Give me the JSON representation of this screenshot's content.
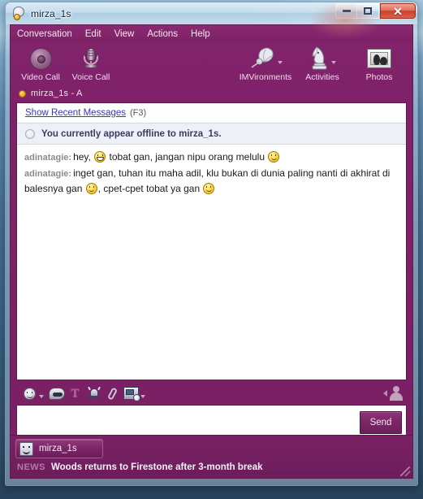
{
  "window": {
    "title": "mirza_1s",
    "title_icon": "yahoo-messenger-icon",
    "controls": {
      "minimize": "minimize-icon",
      "maximize": "maximize-icon",
      "close": "✕"
    }
  },
  "menu": {
    "items": [
      {
        "label": "Conversation"
      },
      {
        "label": "Edit"
      },
      {
        "label": "View"
      },
      {
        "label": "Actions"
      },
      {
        "label": "Help"
      }
    ]
  },
  "toolbar": {
    "left": [
      {
        "label": "Video Call",
        "icon": "webcam-icon"
      },
      {
        "label": "Voice Call",
        "icon": "microphone-icon"
      }
    ],
    "right": [
      {
        "label": "IMVironments",
        "icon": "leaf-icon"
      },
      {
        "label": "Activities",
        "icon": "chess-knight-icon"
      },
      {
        "label": "Photos",
        "icon": "photo-frame-icon"
      }
    ]
  },
  "im_status": {
    "dot_color": "#f0a91d",
    "text": "mirza_1s  -  A"
  },
  "chat": {
    "recent_link": "Show Recent Messages",
    "recent_shortcut": "(F3)",
    "offline_notice": "You currently appear offline to mirza_1s.",
    "messages": [
      {
        "sender": "adinatagie:",
        "segments": [
          {
            "type": "text",
            "value": "hey, "
          },
          {
            "type": "emoticon",
            "value": "grin"
          },
          {
            "type": "text",
            "value": " tobat gan, jangan nipu orang melulu "
          },
          {
            "type": "emoticon",
            "value": "smile"
          }
        ]
      },
      {
        "sender": "adinatagie:",
        "segments": [
          {
            "type": "text",
            "value": "inget gan, tuhan itu maha adil, klu bukan di dunia paling nanti di akhirat di balesnya gan "
          },
          {
            "type": "emoticon",
            "value": "smile"
          },
          {
            "type": "text",
            "value": ", cpet-cpet tobat ya gan "
          },
          {
            "type": "emoticon",
            "value": "smile"
          }
        ]
      }
    ]
  },
  "input_toolbar": {
    "buttons": [
      {
        "name": "emoticon-icon",
        "has_caret": true
      },
      {
        "name": "audibles-icon",
        "has_caret": false
      },
      {
        "name": "font-icon",
        "has_caret": false
      },
      {
        "name": "buzz-icon",
        "has_caret": false
      },
      {
        "name": "attach-file-icon",
        "has_caret": false
      },
      {
        "name": "share-screen-icon",
        "has_caret": true
      }
    ],
    "avatar": "avatar-icon"
  },
  "compose": {
    "value": "",
    "placeholder": "",
    "send_label": "Send"
  },
  "taskbar": {
    "button_label": "mirza_1s",
    "button_icon": "smiley-icon",
    "news_tag": "NEWS",
    "news_headline": "Woods returns to Firestone after 3-month break"
  },
  "colors": {
    "skin_purple": "#7a1d63",
    "menu_purple": "#8a2a72",
    "link_blue": "#3a3ab0",
    "notice_bg": "#eef0f8",
    "status_orange": "#f0a91d"
  }
}
